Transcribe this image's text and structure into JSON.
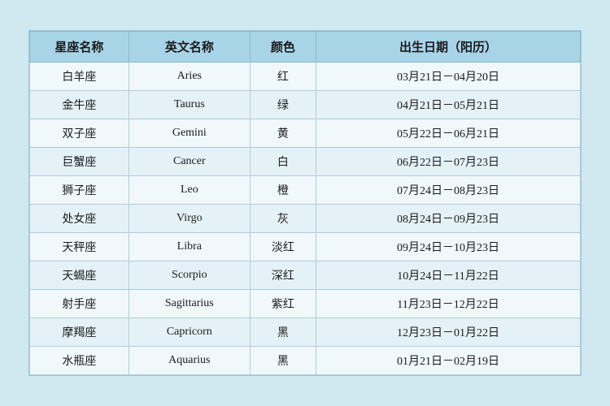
{
  "table": {
    "headers": [
      "星座名称",
      "英文名称",
      "颜色",
      "出生日期（阳历）"
    ],
    "rows": [
      {
        "zh": "白羊座",
        "en": "Aries",
        "color": "红",
        "date": "03月21日－04月20日"
      },
      {
        "zh": "金牛座",
        "en": "Taurus",
        "color": "绿",
        "date": "04月21日－05月21日"
      },
      {
        "zh": "双子座",
        "en": "Gemini",
        "color": "黄",
        "date": "05月22日－06月21日"
      },
      {
        "zh": "巨蟹座",
        "en": "Cancer",
        "color": "白",
        "date": "06月22日－07月23日"
      },
      {
        "zh": "狮子座",
        "en": "Leo",
        "color": "橙",
        "date": "07月24日－08月23日"
      },
      {
        "zh": "处女座",
        "en": "Virgo",
        "color": "灰",
        "date": "08月24日－09月23日"
      },
      {
        "zh": "天秤座",
        "en": "Libra",
        "color": "淡红",
        "date": "09月24日－10月23日"
      },
      {
        "zh": "天蝎座",
        "en": "Scorpio",
        "color": "深红",
        "date": "10月24日－11月22日"
      },
      {
        "zh": "射手座",
        "en": "Sagittarius",
        "color": "紫红",
        "date": "11月23日－12月22日"
      },
      {
        "zh": "摩羯座",
        "en": "Capricorn",
        "color": "黑",
        "date": "12月23日－01月22日"
      },
      {
        "zh": "水瓶座",
        "en": "Aquarius",
        "color": "黑",
        "date": "01月21日－02月19日"
      }
    ]
  }
}
